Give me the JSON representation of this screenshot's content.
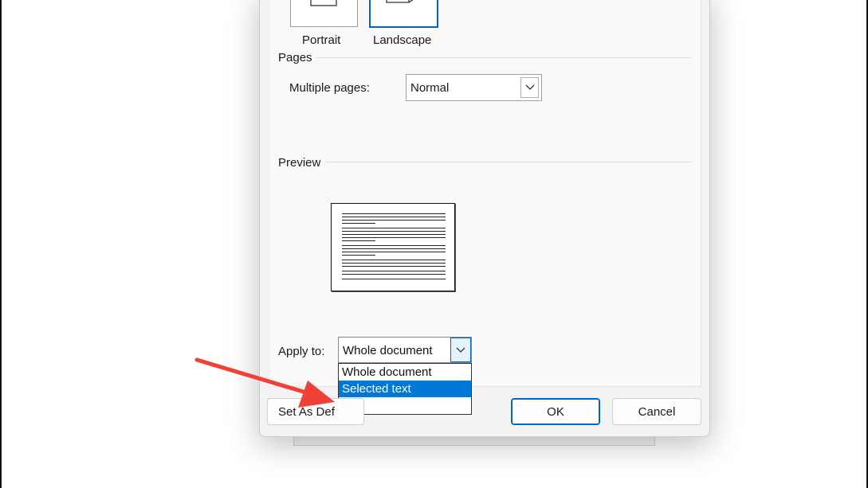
{
  "orientation": {
    "portrait_label": "Portrait",
    "landscape_label": "Landscape",
    "selected": "Landscape"
  },
  "pages": {
    "section_title": "Pages",
    "multiple_pages_label": "Multiple pages:",
    "multiple_pages_value": "Normal"
  },
  "preview": {
    "section_title": "Preview"
  },
  "apply_to": {
    "label": "Apply to:",
    "value": "Whole document",
    "options": [
      "Whole document",
      "Selected text"
    ],
    "highlighted_option": "Selected text"
  },
  "buttons": {
    "set_as_default_visible": "Set As Def",
    "ok": "OK",
    "cancel": "Cancel"
  },
  "colors": {
    "accent": "#0067c0",
    "selection": "#0078d7",
    "annotation_arrow": "#ef4136"
  }
}
